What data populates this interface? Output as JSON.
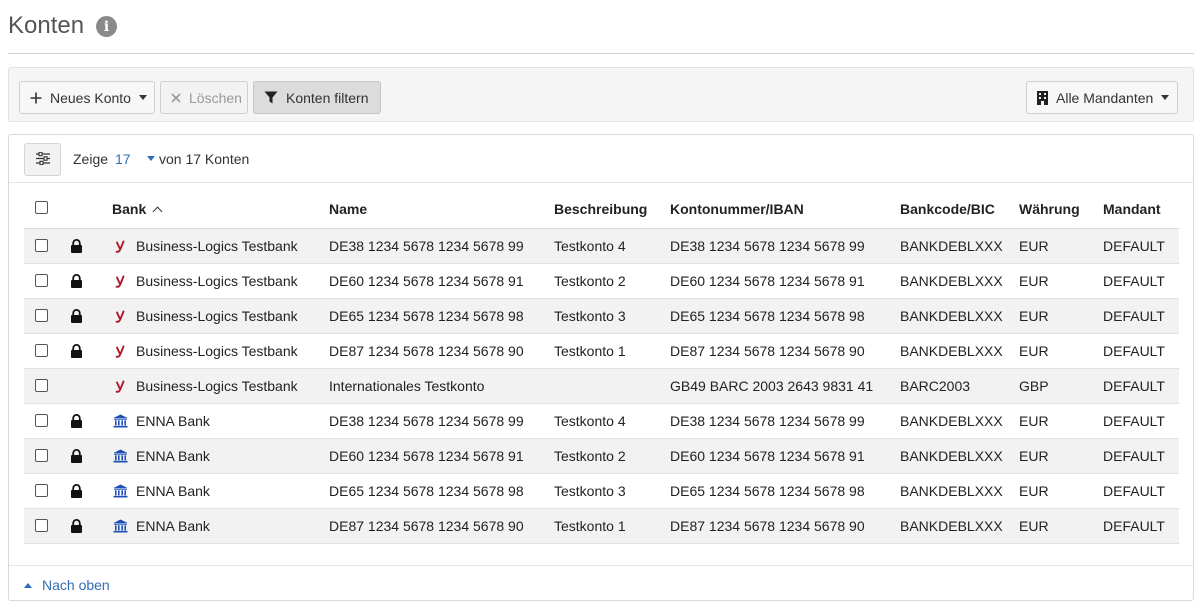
{
  "page": {
    "title": "Konten",
    "info_icon": "info-icon"
  },
  "toolbar": {
    "new_account_label": "Neues Konto",
    "delete_label": "Löschen",
    "filter_label": "Konten filtern",
    "mandanten_label": "Alle Mandanten"
  },
  "pager": {
    "show_label": "Zeige",
    "page_size": "17",
    "total_label": "von 17 Konten"
  },
  "table": {
    "headers": {
      "bank": "Bank",
      "name": "Name",
      "description": "Beschreibung",
      "iban": "Kontonummer/IBAN",
      "bic": "Bankcode/BIC",
      "currency": "Währung",
      "mandant": "Mandant"
    },
    "sort": {
      "column": "Bank",
      "direction": "ascending"
    },
    "rows": [
      {
        "locked": true,
        "bank_icon": "business-logics-icon",
        "bank": "Business-Logics Testbank",
        "name": "DE38 1234 5678 1234 5678 99",
        "description": "Testkonto 4",
        "iban": "DE38 1234 5678 1234 5678 99",
        "bic": "BANKDEBLXXX",
        "currency": "EUR",
        "mandant": "DEFAULT"
      },
      {
        "locked": true,
        "bank_icon": "business-logics-icon",
        "bank": "Business-Logics Testbank",
        "name": "DE60 1234 5678 1234 5678 91",
        "description": "Testkonto 2",
        "iban": "DE60 1234 5678 1234 5678 91",
        "bic": "BANKDEBLXXX",
        "currency": "EUR",
        "mandant": "DEFAULT"
      },
      {
        "locked": true,
        "bank_icon": "business-logics-icon",
        "bank": "Business-Logics Testbank",
        "name": "DE65 1234 5678 1234 5678 98",
        "description": "Testkonto 3",
        "iban": "DE65 1234 5678 1234 5678 98",
        "bic": "BANKDEBLXXX",
        "currency": "EUR",
        "mandant": "DEFAULT"
      },
      {
        "locked": true,
        "bank_icon": "business-logics-icon",
        "bank": "Business-Logics Testbank",
        "name": "DE87 1234 5678 1234 5678 90",
        "description": "Testkonto 1",
        "iban": "DE87 1234 5678 1234 5678 90",
        "bic": "BANKDEBLXXX",
        "currency": "EUR",
        "mandant": "DEFAULT"
      },
      {
        "locked": false,
        "bank_icon": "business-logics-icon",
        "bank": "Business-Logics Testbank",
        "name": "Internationales Testkonto",
        "description": "",
        "iban": "GB49 BARC 2003 2643 9831 41",
        "bic": "BARC2003",
        "currency": "GBP",
        "mandant": "DEFAULT"
      },
      {
        "locked": true,
        "bank_icon": "bank-building-icon",
        "bank": "ENNA Bank",
        "name": "DE38 1234 5678 1234 5678 99",
        "description": "Testkonto 4",
        "iban": "DE38 1234 5678 1234 5678 99",
        "bic": "BANKDEBLXXX",
        "currency": "EUR",
        "mandant": "DEFAULT"
      },
      {
        "locked": true,
        "bank_icon": "bank-building-icon",
        "bank": "ENNA Bank",
        "name": "DE60 1234 5678 1234 5678 91",
        "description": "Testkonto 2",
        "iban": "DE60 1234 5678 1234 5678 91",
        "bic": "BANKDEBLXXX",
        "currency": "EUR",
        "mandant": "DEFAULT"
      },
      {
        "locked": true,
        "bank_icon": "bank-building-icon",
        "bank": "ENNA Bank",
        "name": "DE65 1234 5678 1234 5678 98",
        "description": "Testkonto 3",
        "iban": "DE65 1234 5678 1234 5678 98",
        "bic": "BANKDEBLXXX",
        "currency": "EUR",
        "mandant": "DEFAULT"
      },
      {
        "locked": true,
        "bank_icon": "bank-building-icon",
        "bank": "ENNA Bank",
        "name": "DE87 1234 5678 1234 5678 90",
        "description": "Testkonto 1",
        "iban": "DE87 1234 5678 1234 5678 90",
        "bic": "BANKDEBLXXX",
        "currency": "EUR",
        "mandant": "DEFAULT"
      }
    ]
  },
  "footer": {
    "back_to_top_label": "Nach oben"
  },
  "colors": {
    "link": "#2f6eb4",
    "business_logics_icon": "#b0182a",
    "bank_icon": "#1f4fb3"
  }
}
